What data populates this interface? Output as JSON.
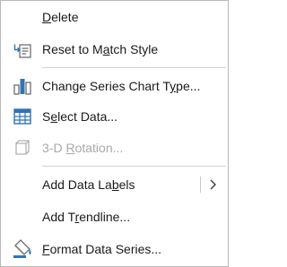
{
  "menu": {
    "items": [
      {
        "pre": "",
        "ul": "D",
        "post": "elete"
      },
      {
        "pre": "Reset to M",
        "ul": "a",
        "post": "tch Style"
      },
      {
        "pre": "Change Series Chart T",
        "ul": "y",
        "post": "pe..."
      },
      {
        "pre": "S",
        "ul": "e",
        "post": "lect Data..."
      },
      {
        "pre": "3-D ",
        "ul": "R",
        "post": "otation..."
      },
      {
        "pre": "Add Data La",
        "ul": "b",
        "post": "els"
      },
      {
        "pre": "Add T",
        "ul": "r",
        "post": "endline..."
      },
      {
        "pre": "",
        "ul": "F",
        "post": "ormat Data Series..."
      }
    ]
  },
  "colors": {
    "accent_blue": "#2e75b6",
    "icon_gray": "#6e6e6e",
    "disabled": "#a8a8a8"
  },
  "icons": [
    "reset-style-icon",
    "chart-type-icon",
    "select-data-icon",
    "rotation-3d-icon",
    "chevron-right-icon",
    "format-paint-icon"
  ]
}
